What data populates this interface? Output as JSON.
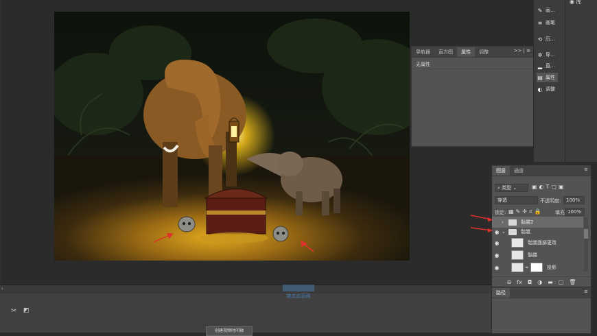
{
  "properties_panel": {
    "tabs": [
      "导航器",
      "直方图",
      "属性",
      "调整"
    ],
    "active_tab": "属性",
    "controls": ">> | ≡",
    "empty_text": "无属性"
  },
  "dock": {
    "items": [
      {
        "icon": "brush-icon",
        "label": "画…"
      },
      {
        "icon": "brush-settings-icon",
        "label": "画笔"
      },
      {
        "icon": "history-icon",
        "label": "历…"
      },
      {
        "icon": "navigator-icon",
        "label": "导…"
      },
      {
        "icon": "histogram-icon",
        "label": "直…"
      },
      {
        "icon": "properties-icon",
        "label": "属性"
      },
      {
        "icon": "adjustments-icon",
        "label": "调整"
      }
    ],
    "top_right_label": "库"
  },
  "layers_panel": {
    "tabs": [
      "图层",
      "通道"
    ],
    "active_tab": "图层",
    "filter_kind": "类型",
    "blend_mode": "穿透",
    "opacity_label": "不透明度:",
    "opacity_value": "100%",
    "lock_label": "锁定:",
    "fill_label": "填充:",
    "fill_value": "100%",
    "layers": [
      {
        "name": "骷髅2",
        "type": "group",
        "visible": false,
        "selected": true
      },
      {
        "name": "骷髅",
        "type": "group",
        "visible": true,
        "selected": false
      },
      {
        "name": "骷髅面部更改",
        "type": "layer",
        "visible": true,
        "selected": false
      },
      {
        "name": "骷髅",
        "type": "layer",
        "visible": true,
        "selected": false
      },
      {
        "name": "投影",
        "type": "layer-mask",
        "visible": true,
        "selected": false
      }
    ],
    "footer_icons": [
      "link-icon",
      "fx-icon",
      "mask-icon",
      "adjustment-icon",
      "folder-icon",
      "new-layer-icon",
      "trash-icon"
    ]
  },
  "paths_panel": {
    "title": "路径"
  },
  "timeline": {
    "create_button": "创建视频时间轴"
  },
  "watermark": {
    "line1": "",
    "line2": "铁瓜瓜百网"
  },
  "colors": {
    "canvas_bg": "#15180f",
    "panel_bg": "#535353",
    "app_bg": "#2b2b2b",
    "arrow": "#e0312a",
    "glow": "#f5c21b"
  }
}
